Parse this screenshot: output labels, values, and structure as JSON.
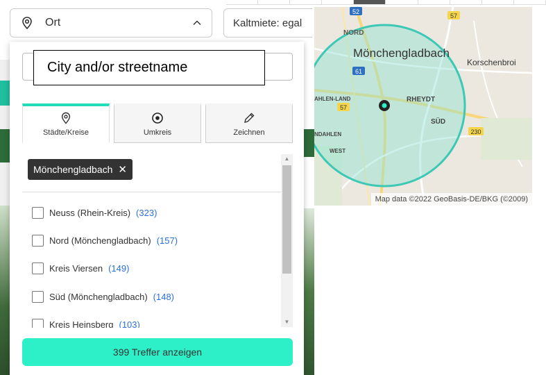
{
  "filters": {
    "location_label": "Ort",
    "rent_label": "Kaltmiete: egal"
  },
  "search": {
    "placeholder": "",
    "annotation": "City and/or streetname"
  },
  "tabs": [
    {
      "label": "Städte/Kreise",
      "icon": "location-pin-icon",
      "active": true
    },
    {
      "label": "Umkreis",
      "icon": "radius-target-icon",
      "active": false
    },
    {
      "label": "Zeichnen",
      "icon": "pencil-icon",
      "active": false
    }
  ],
  "selected_chip": {
    "label": "Mönchengladbach",
    "remove": "✕"
  },
  "list": [
    {
      "name": "Neuss (Rhein-Kreis)",
      "count": "(323)"
    },
    {
      "name": "Nord (Mönchengladbach)",
      "count": "(157)"
    },
    {
      "name": "Kreis Viersen",
      "count": "(149)"
    },
    {
      "name": "Süd (Mönchengladbach)",
      "count": "(148)"
    },
    {
      "name": "Kreis Heinsberg",
      "count": "(103)"
    }
  ],
  "submit_label": "399 Treffer anzeigen",
  "map": {
    "city_label": "Mönchengladbach",
    "district_labels": [
      "NORD",
      "RHEYDT",
      "SÜD",
      "AHLEN-LAND",
      "NDAHLEN",
      "WEST",
      "Korschenbroi"
    ],
    "road_shields": [
      "52",
      "57",
      "61",
      "57",
      "230"
    ],
    "attribution": "Map data ©2022 GeoBasis-DE/BKG (©2009)",
    "radius_color": "#3cc8b4"
  },
  "colors": {
    "accent": "#2ef0c8",
    "tab_active_border": "#22ddb9",
    "chip_bg": "#333333",
    "count_link": "#2a6fdb"
  }
}
